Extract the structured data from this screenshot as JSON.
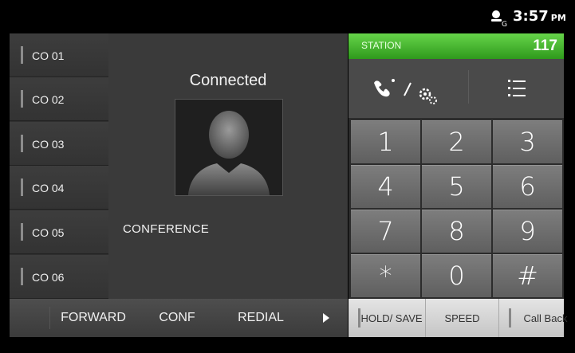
{
  "status_bar": {
    "time": "3:57",
    "ampm": "PM",
    "icons": [
      "sync-account-icon"
    ]
  },
  "co_lines": [
    {
      "label": "CO 01"
    },
    {
      "label": "CO 02"
    },
    {
      "label": "CO 03"
    },
    {
      "label": "CO 04"
    },
    {
      "label": "CO 05"
    },
    {
      "label": "CO 06"
    }
  ],
  "call": {
    "status": "Connected",
    "mode": "CONFERENCE"
  },
  "station": {
    "label": "STATION",
    "number": "117"
  },
  "toolbar": {
    "tools": [
      "call-settings-icon",
      "menu-list-icon"
    ]
  },
  "keypad": {
    "keys": [
      "1",
      "2",
      "3",
      "4",
      "5",
      "6",
      "7",
      "8",
      "9",
      "*",
      "0",
      "#"
    ]
  },
  "bottom_left": {
    "forward": "FORWARD",
    "conf": "CONF",
    "redial": "REDIAL",
    "more_icon": "play-icon"
  },
  "bottom_right": {
    "hold_save": "HOLD/ SAVE",
    "speed": "SPEED",
    "call_back": "Call Back"
  },
  "colors": {
    "accent_green": "#3db827",
    "background": "#000000"
  }
}
